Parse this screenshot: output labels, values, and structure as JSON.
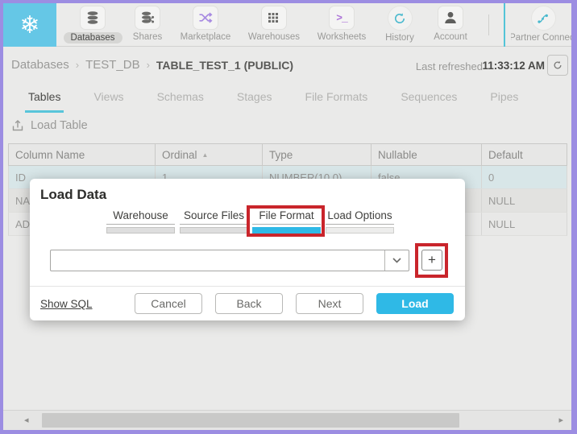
{
  "topnav": {
    "items": [
      {
        "label": "Databases",
        "active": true
      },
      {
        "label": "Shares",
        "active": false
      },
      {
        "label": "Marketplace",
        "active": false
      },
      {
        "label": "Warehouses",
        "active": false
      },
      {
        "label": "Worksheets",
        "active": false
      },
      {
        "label": "History",
        "active": false
      },
      {
        "label": "Account",
        "active": false
      },
      {
        "label": "Partner Connect",
        "active": false
      }
    ]
  },
  "breadcrumb": {
    "items": [
      "Databases",
      "TEST_DB",
      "TABLE_TEST_1 (PUBLIC)"
    ],
    "separator": "›"
  },
  "refresh": {
    "label": "Last refreshed",
    "time": "11:33:12 AM"
  },
  "tabs": {
    "items": [
      "Tables",
      "Views",
      "Schemas",
      "Stages",
      "File Formats",
      "Sequences",
      "Pipes"
    ],
    "active": "Tables"
  },
  "toolbar": {
    "load_table_label": "Load Table"
  },
  "table": {
    "headers": [
      "Column Name",
      "Ordinal",
      "Type",
      "Nullable",
      "Default"
    ],
    "sorted_column": "Ordinal",
    "rows": [
      [
        "ID",
        "1",
        "NUMBER(10,0)",
        "false",
        "0"
      ],
      [
        "NA",
        "",
        "",
        "",
        "NULL"
      ],
      [
        "AD",
        "",
        "",
        "",
        "NULL"
      ]
    ]
  },
  "modal": {
    "title": "Load Data",
    "steps": [
      {
        "label": "Warehouse",
        "state": "done"
      },
      {
        "label": "Source Files",
        "state": "done"
      },
      {
        "label": "File Format",
        "state": "active",
        "highlighted": true
      },
      {
        "label": "Load Options",
        "state": "todo"
      }
    ],
    "file_format_select": {
      "value": ""
    },
    "add_button_label": "+",
    "footer": {
      "show_sql": "Show SQL",
      "cancel": "Cancel",
      "back": "Back",
      "next": "Next",
      "load": "Load"
    }
  },
  "icons": {
    "snowflake": "❄",
    "worksheets_glyph": ">_",
    "sort_asc": "▲",
    "scroll_left": "◂",
    "scroll_right": "▸",
    "plus": "+"
  },
  "colors": {
    "accent_cyan": "#2fb9e6",
    "tab_underline": "#58c5da",
    "highlight_red": "#c9252b",
    "frame_purple": "#9c8de2",
    "logo_cyan": "#65c7e6",
    "selected_row": "#d8e6e8",
    "teal_divider": "#53c4d8"
  }
}
